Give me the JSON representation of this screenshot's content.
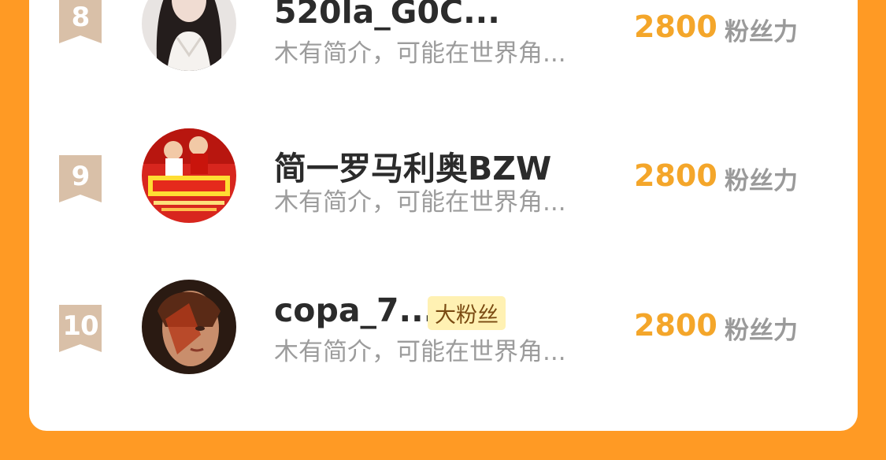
{
  "ranking": [
    {
      "rank": "8",
      "name": "520la_G0C...",
      "tag": "",
      "bio": "木有简介，可能在世界角...",
      "score": "2800",
      "unit": "粉丝力",
      "avatar_icon": "avatar-girl-long-hair"
    },
    {
      "rank": "9",
      "name": "简一罗马利奥BZW",
      "tag": "",
      "bio": "木有简介，可能在世界角...",
      "score": "2800",
      "unit": "粉丝力",
      "avatar_icon": "avatar-red-poster"
    },
    {
      "rank": "10",
      "name": "copa_7...",
      "tag": "大粉丝",
      "bio": "木有简介，可能在世界角...",
      "score": "2800",
      "unit": "粉丝力",
      "avatar_icon": "avatar-portrait-art"
    }
  ],
  "colors": {
    "background": "#ff9a24",
    "score": "#f4a62a",
    "rank_badge": "#d9c0a8"
  }
}
